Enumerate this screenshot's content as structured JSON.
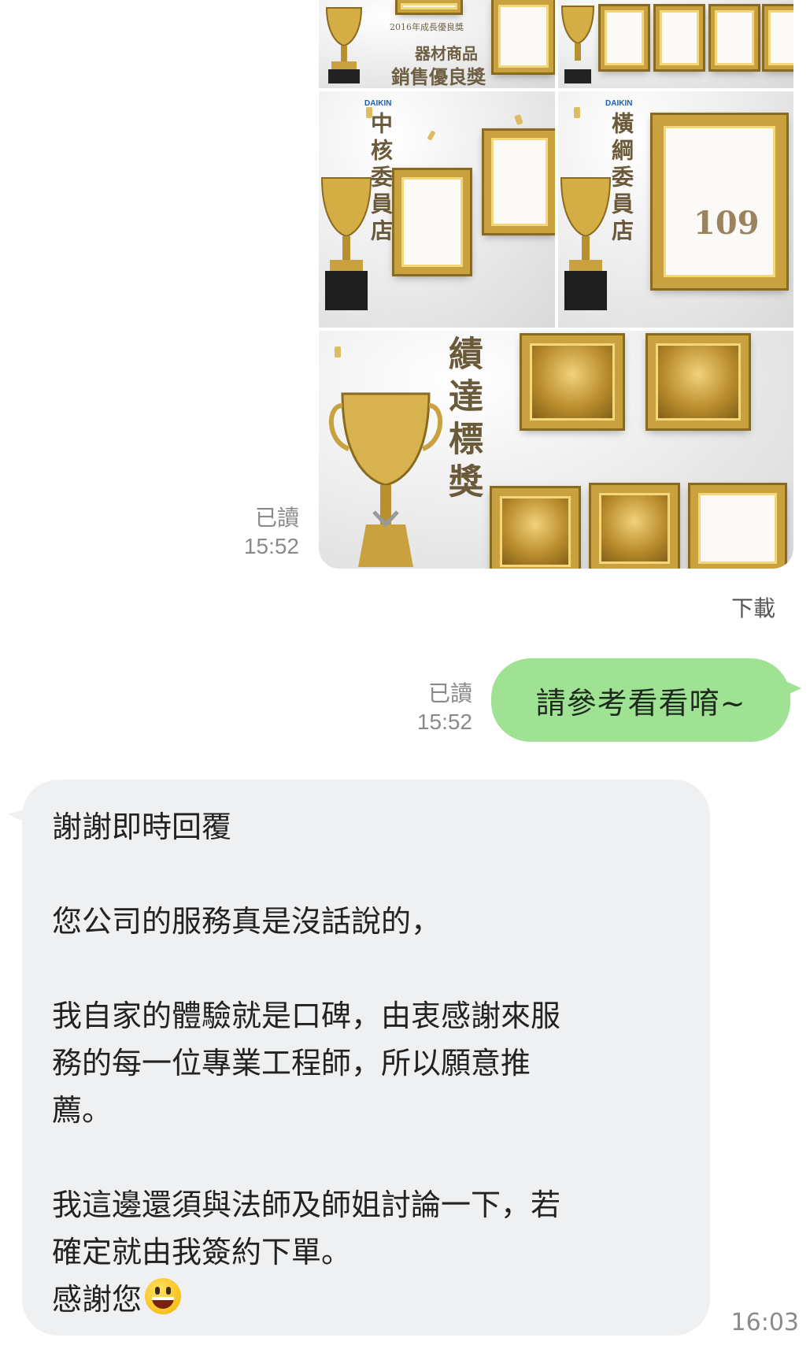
{
  "image_message": {
    "tiles": {
      "top_left_caption_small": "2016年成長優良獎",
      "top_left_caption_line1": "器材商品",
      "top_left_caption_line2": "銷售優良獎",
      "mid_left_title": "中核委員店",
      "mid_right_title": "橫綱委員店",
      "bottom_title": "績達標獎",
      "brand": "DAIKIN",
      "mid_right_badge": "109"
    },
    "status": {
      "read": "已讀",
      "time": "15:52"
    },
    "download_label": "下載"
  },
  "sent_message": {
    "text": "請參考看看唷~",
    "status": {
      "read": "已讀",
      "time": "15:52"
    }
  },
  "received_message": {
    "lines": [
      "謝謝即時回覆",
      "",
      "您公司的服務真是沒話說的，",
      "",
      "我自家的體驗就是口碑，由衷感謝來服",
      "務的每一位專業工程師，所以願意推",
      "薦。",
      "",
      "我這邊還須與法師及師姐討論一下，若",
      "確定就由我簽約下單。"
    ],
    "last_line": "感謝您",
    "emoji": "grinning-face-emoji",
    "time": "16:03"
  },
  "colors": {
    "sent_bubble": "#9fe294",
    "received_bubble": "#eff0f2",
    "meta_text": "#8a8a8a",
    "gold": "#c9a23f"
  }
}
